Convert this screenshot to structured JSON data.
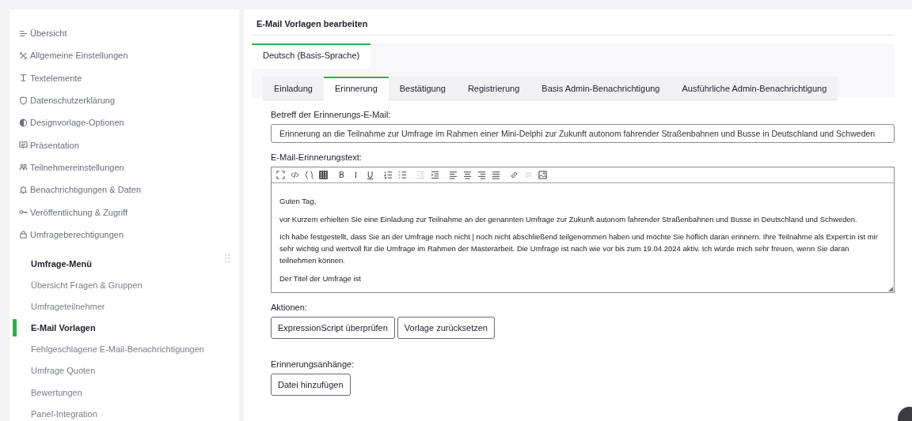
{
  "sidebar": {
    "items": [
      {
        "kind": "overview",
        "label": "Übersicht"
      },
      {
        "kind": "tools",
        "label": "Allgemeine Einstellungen"
      },
      {
        "kind": "text",
        "label": "Textelemente"
      },
      {
        "kind": "shield",
        "label": "Datenschutzerklärung"
      },
      {
        "kind": "contrast",
        "label": "Designvorlage-Optionen"
      },
      {
        "kind": "presentation",
        "label": "Präsentation"
      },
      {
        "kind": "people",
        "label": "Teilnehmereinstellungen"
      },
      {
        "kind": "bell",
        "label": "Benachrichtigungen & Daten"
      },
      {
        "kind": "key",
        "label": "Veröffentlichung & Zugriff"
      },
      {
        "kind": "lock",
        "label": "Umfrageberechtigungen"
      }
    ],
    "section": {
      "title": "Umfrage-Menü",
      "items": [
        {
          "label": "Übersicht Fragen & Gruppen",
          "selected": false
        },
        {
          "label": "Umfrageteilnehmer",
          "selected": false
        },
        {
          "label": "E-Mail Vorlagen",
          "selected": true
        },
        {
          "label": "Fehlgeschlagene E-Mail-Benachrichtigungen",
          "selected": false
        },
        {
          "label": "Umfrage Quoten",
          "selected": false
        },
        {
          "label": "Bewertungen",
          "selected": false
        },
        {
          "label": "Panel-Integration",
          "selected": false
        }
      ]
    }
  },
  "page": {
    "title": "E-Mail Vorlagen bearbeiten",
    "language_tabs": [
      {
        "label": "Deutsch (Basis-Sprache)",
        "selected": true
      }
    ],
    "tabs": [
      {
        "label": "Einladung",
        "selected": false
      },
      {
        "label": "Erinnerung",
        "selected": true
      },
      {
        "label": "Bestätigung",
        "selected": false
      },
      {
        "label": "Registrierung",
        "selected": false
      },
      {
        "label": "Basis Admin-Benachrichtigung",
        "selected": false
      },
      {
        "label": "Ausführliche Admin-Benachrichtigung",
        "selected": false
      }
    ],
    "subject": {
      "label": "Betreff der Erinnerungs-E-Mail:",
      "value": "Erinnerung an die Teilnahme zur Umfrage im Rahmen einer Mini-Delphi zur Zukunft autonom fahrender Straßenbahnen und Busse in Deutschland und Schweden"
    },
    "body": {
      "label": "E-Mail-Erinnerungstext:",
      "toolbar": [
        [
          {
            "kind": "fullscreen",
            "disabled": false
          },
          {
            "kind": "code",
            "disabled": false
          },
          {
            "kind": "braces",
            "disabled": false
          },
          {
            "kind": "grid",
            "disabled": false
          }
        ],
        [
          {
            "kind": "bold",
            "label": "B",
            "disabled": false
          },
          {
            "kind": "italic",
            "label": "I",
            "disabled": false
          },
          {
            "kind": "underline",
            "label": "U",
            "disabled": false
          }
        ],
        [
          {
            "kind": "ordered-list",
            "disabled": false
          },
          {
            "kind": "bullet-list",
            "disabled": false
          }
        ],
        [
          {
            "kind": "outdent",
            "disabled": true
          },
          {
            "kind": "indent",
            "disabled": false
          }
        ],
        [
          {
            "kind": "align-left",
            "disabled": false
          },
          {
            "kind": "align-center",
            "disabled": false
          },
          {
            "kind": "align-right",
            "disabled": false
          },
          {
            "kind": "justify",
            "disabled": false
          }
        ],
        [
          {
            "kind": "link",
            "disabled": false
          },
          {
            "kind": "unlink",
            "disabled": true
          },
          {
            "kind": "image",
            "disabled": false
          }
        ]
      ],
      "paragraphs": [
        "Guten Tag,",
        "vor Kurzem erhielten Sie eine Einladung zur Teilnahme an der genannten Umfrage zur Zukunft autonom fahrender Straßenbahnen und Busse in Deutschland und Schweden.",
        "Ich habe festgestellt, dass Sie an der Umfrage noch nicht | noch nicht abschließend teilgenommen haben und möchte Sie höflich daran erinnern. Ihre Teilnahme als Expert:in ist mir sehr wichtig und wertvoll für die Umfrage im Rahmen der Masterarbeit. Die Umfrage ist nach wie vor bis zum 19.04.2024 aktiv. Ich würde mich sehr freuen, wenn Sie daran teilnehmen können.",
        "Der Titel der Umfrage ist"
      ]
    },
    "actions": {
      "label": "Aktionen:",
      "buttons": [
        "ExpressionScript überprüfen",
        "Vorlage zurücksetzen"
      ]
    },
    "attachments": {
      "label": "Erinnerungsanhänge:",
      "buttons": [
        "Datei hinzufügen"
      ]
    }
  }
}
